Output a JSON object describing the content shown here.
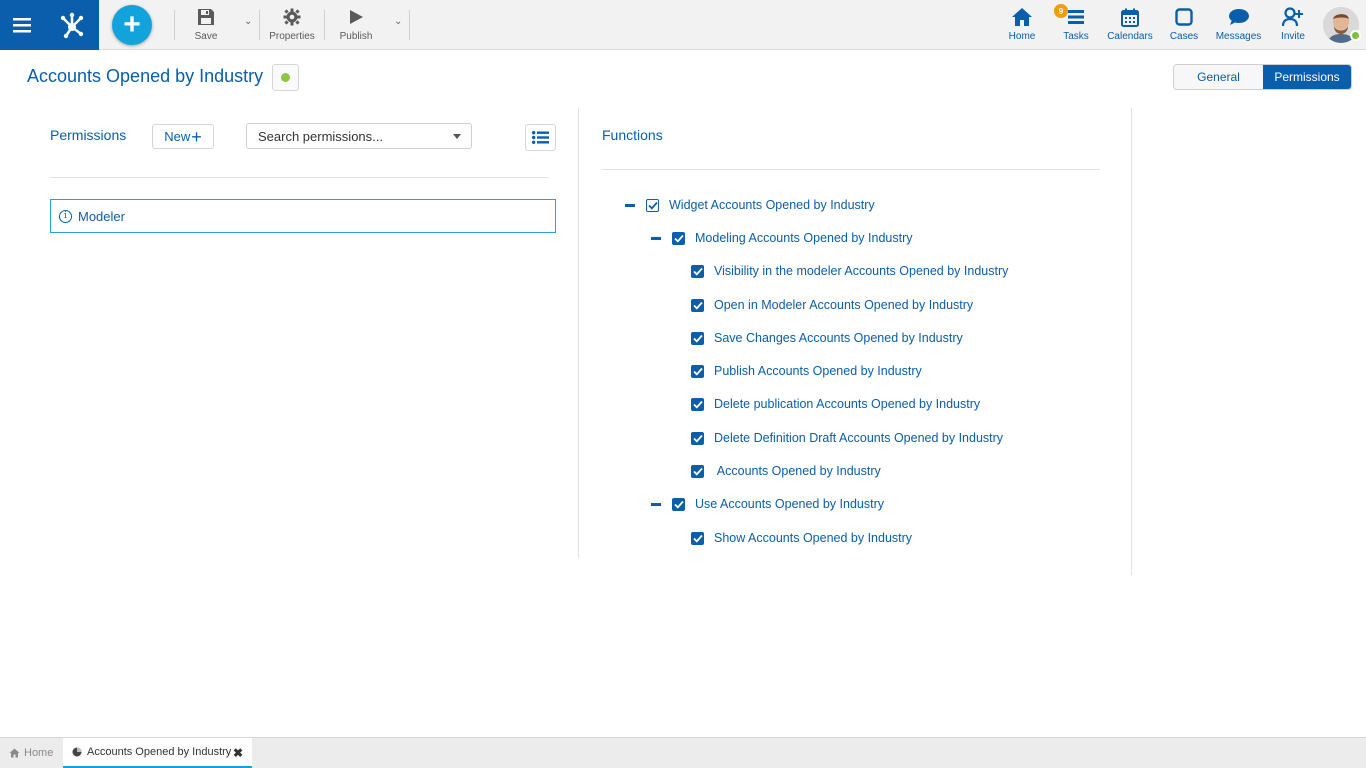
{
  "toolbar": {
    "save_label": "Save",
    "properties_label": "Properties",
    "publish_label": "Publish"
  },
  "nav": {
    "home_label": "Home",
    "tasks_label": "Tasks",
    "tasks_badge": "9",
    "calendars_label": "Calendars",
    "cases_label": "Cases",
    "messages_label": "Messages",
    "invite_label": "Invite"
  },
  "header": {
    "title": "Accounts Opened by Industry",
    "status_color": "#8dc63f",
    "tabs": {
      "general": "General",
      "permissions": "Permissions"
    },
    "active_tab": "Permissions"
  },
  "left": {
    "title": "Permissions",
    "new_label": "New",
    "search_placeholder": "Search permissions...",
    "items": [
      {
        "label": "Modeler"
      }
    ]
  },
  "right": {
    "title": "Functions",
    "tree": [
      {
        "label": "Widget Accounts Opened by Industry",
        "level": 0,
        "collapsible": true,
        "checked": "partial"
      },
      {
        "label": "Modeling Accounts Opened by Industry",
        "level": 1,
        "collapsible": true,
        "checked": true
      },
      {
        "label": "Visibility in the modeler Accounts Opened by Industry",
        "level": 2,
        "checked": true
      },
      {
        "label": "Open in Modeler Accounts Opened by Industry",
        "level": 2,
        "checked": true
      },
      {
        "label": "Save Changes Accounts Opened by Industry",
        "level": 2,
        "checked": true
      },
      {
        "label": "Publish Accounts Opened by Industry",
        "level": 2,
        "checked": true
      },
      {
        "label": "Delete publication Accounts Opened by Industry",
        "level": 2,
        "checked": true
      },
      {
        "label": "Delete Definition Draft Accounts Opened by Industry",
        "level": 2,
        "checked": true
      },
      {
        "label": " Accounts Opened by Industry",
        "level": 2,
        "checked": true
      },
      {
        "label": "Use Accounts Opened by Industry",
        "level": 1,
        "collapsible": true,
        "checked": true
      },
      {
        "label": "Show Accounts Opened by Industry",
        "level": 2,
        "checked": true
      }
    ]
  },
  "bottom_tabs": {
    "home_label": "Home",
    "active_label": "Accounts Opened by Industry"
  },
  "colors": {
    "primary": "#0a5eab",
    "accent": "#12a3dd",
    "badge": "#f39c12",
    "online": "#7cc142"
  }
}
